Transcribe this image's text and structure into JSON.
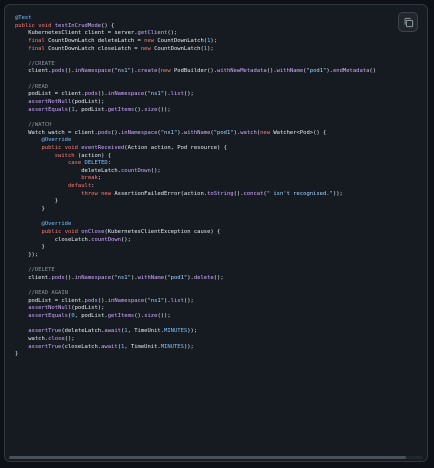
{
  "copy_button": {
    "icon": "copy-icon"
  },
  "code_lines": [
    [
      [
        "anno",
        "@Test"
      ]
    ],
    [
      [
        "kw",
        "public"
      ],
      [
        "plain",
        " "
      ],
      [
        "kw",
        "void"
      ],
      [
        "plain",
        " "
      ],
      [
        "fn",
        "testInCrudMode"
      ],
      [
        "plain",
        "() {"
      ]
    ],
    [
      [
        "plain",
        "    KubernetesClient client = server."
      ],
      [
        "fn",
        "getClient"
      ],
      [
        "plain",
        "();"
      ]
    ],
    [
      [
        "plain",
        "    "
      ],
      [
        "kw",
        "final"
      ],
      [
        "plain",
        " CountDownLatch deleteLatch = "
      ],
      [
        "kw",
        "new"
      ],
      [
        "plain",
        " CountDownLatch("
      ],
      [
        "num",
        "1"
      ],
      [
        "plain",
        ");"
      ]
    ],
    [
      [
        "plain",
        "    "
      ],
      [
        "kw",
        "final"
      ],
      [
        "plain",
        " CountDownLatch closeLatch = "
      ],
      [
        "kw",
        "new"
      ],
      [
        "plain",
        " CountDownLatch("
      ],
      [
        "num",
        "1"
      ],
      [
        "plain",
        ");"
      ]
    ],
    [
      [
        "plain",
        ""
      ]
    ],
    [
      [
        "comment",
        "    //CREATE"
      ]
    ],
    [
      [
        "plain",
        "    client."
      ],
      [
        "fn",
        "pods"
      ],
      [
        "plain",
        "()."
      ],
      [
        "fn",
        "inNamespace"
      ],
      [
        "plain",
        "("
      ],
      [
        "str",
        "\"ns1\""
      ],
      [
        "plain",
        ")."
      ],
      [
        "fn",
        "create"
      ],
      [
        "plain",
        "("
      ],
      [
        "kw",
        "new"
      ],
      [
        "plain",
        " PodBuilder()."
      ],
      [
        "fn",
        "withNewMetadata"
      ],
      [
        "plain",
        "()."
      ],
      [
        "fn",
        "withName"
      ],
      [
        "plain",
        "("
      ],
      [
        "str",
        "\"pod1\""
      ],
      [
        "plain",
        ")."
      ],
      [
        "fn",
        "endMetadata"
      ],
      [
        "plain",
        "()"
      ]
    ],
    [
      [
        "plain",
        ""
      ]
    ],
    [
      [
        "comment",
        "    //READ"
      ]
    ],
    [
      [
        "plain",
        "    podList = client."
      ],
      [
        "fn",
        "pods"
      ],
      [
        "plain",
        "()."
      ],
      [
        "fn",
        "inNamespace"
      ],
      [
        "plain",
        "("
      ],
      [
        "str",
        "\"ns1\""
      ],
      [
        "plain",
        ")."
      ],
      [
        "fn",
        "list"
      ],
      [
        "plain",
        "();"
      ]
    ],
    [
      [
        "plain",
        "    "
      ],
      [
        "fn",
        "assertNotNull"
      ],
      [
        "plain",
        "(podList);"
      ]
    ],
    [
      [
        "plain",
        "    "
      ],
      [
        "fn",
        "assertEquals"
      ],
      [
        "plain",
        "("
      ],
      [
        "num",
        "1"
      ],
      [
        "plain",
        ", podList."
      ],
      [
        "fn",
        "getItems"
      ],
      [
        "plain",
        "()."
      ],
      [
        "fn",
        "size"
      ],
      [
        "plain",
        "());"
      ]
    ],
    [
      [
        "plain",
        ""
      ]
    ],
    [
      [
        "comment",
        "    //WATCH"
      ]
    ],
    [
      [
        "plain",
        "    Watch watch = client."
      ],
      [
        "fn",
        "pods"
      ],
      [
        "plain",
        "()."
      ],
      [
        "fn",
        "inNamespace"
      ],
      [
        "plain",
        "("
      ],
      [
        "str",
        "\"ns1\""
      ],
      [
        "plain",
        ")."
      ],
      [
        "fn",
        "withName"
      ],
      [
        "plain",
        "("
      ],
      [
        "str",
        "\"pod1\""
      ],
      [
        "plain",
        ")."
      ],
      [
        "fn",
        "watch"
      ],
      [
        "plain",
        "("
      ],
      [
        "kw",
        "new"
      ],
      [
        "plain",
        " Watcher<Pod>() {"
      ]
    ],
    [
      [
        "anno",
        "        @Override"
      ]
    ],
    [
      [
        "plain",
        "        "
      ],
      [
        "kw",
        "public"
      ],
      [
        "plain",
        " "
      ],
      [
        "kw",
        "void"
      ],
      [
        "plain",
        " "
      ],
      [
        "fn",
        "eventReceived"
      ],
      [
        "plain",
        "(Action action, Pod resource) {"
      ]
    ],
    [
      [
        "plain",
        "            "
      ],
      [
        "kw",
        "switch"
      ],
      [
        "plain",
        " (action) {"
      ]
    ],
    [
      [
        "plain",
        "                "
      ],
      [
        "kw",
        "case"
      ],
      [
        "plain",
        " "
      ],
      [
        "const",
        "DELETED"
      ],
      [
        "plain",
        ":"
      ]
    ],
    [
      [
        "plain",
        "                    deleteLatch."
      ],
      [
        "fn",
        "countDown"
      ],
      [
        "plain",
        "();"
      ]
    ],
    [
      [
        "plain",
        "                    "
      ],
      [
        "kw",
        "break"
      ],
      [
        "plain",
        ";"
      ]
    ],
    [
      [
        "plain",
        "                "
      ],
      [
        "kw",
        "default"
      ],
      [
        "plain",
        ":"
      ]
    ],
    [
      [
        "plain",
        "                    "
      ],
      [
        "kw",
        "throw"
      ],
      [
        "plain",
        " "
      ],
      [
        "kw",
        "new"
      ],
      [
        "plain",
        " AssertionFailedError(action."
      ],
      [
        "fn",
        "toString"
      ],
      [
        "plain",
        "()."
      ],
      [
        "fn",
        "concat"
      ],
      [
        "plain",
        "("
      ],
      [
        "str",
        "\" isn't recognised.\""
      ],
      [
        "plain",
        "));"
      ]
    ],
    [
      [
        "plain",
        "            }"
      ]
    ],
    [
      [
        "plain",
        "        }"
      ]
    ],
    [
      [
        "plain",
        ""
      ]
    ],
    [
      [
        "anno",
        "        @Override"
      ]
    ],
    [
      [
        "plain",
        "        "
      ],
      [
        "kw",
        "public"
      ],
      [
        "plain",
        " "
      ],
      [
        "kw",
        "void"
      ],
      [
        "plain",
        " "
      ],
      [
        "fn",
        "onClose"
      ],
      [
        "plain",
        "(KubernetesClientException cause) {"
      ]
    ],
    [
      [
        "plain",
        "            closeLatch."
      ],
      [
        "fn",
        "countDown"
      ],
      [
        "plain",
        "();"
      ]
    ],
    [
      [
        "plain",
        "        }"
      ]
    ],
    [
      [
        "plain",
        "    });"
      ]
    ],
    [
      [
        "plain",
        ""
      ]
    ],
    [
      [
        "comment",
        "    //DELETE"
      ]
    ],
    [
      [
        "plain",
        "    client."
      ],
      [
        "fn",
        "pods"
      ],
      [
        "plain",
        "()."
      ],
      [
        "fn",
        "inNamespace"
      ],
      [
        "plain",
        "("
      ],
      [
        "str",
        "\"ns1\""
      ],
      [
        "plain",
        ")."
      ],
      [
        "fn",
        "withName"
      ],
      [
        "plain",
        "("
      ],
      [
        "str",
        "\"pod1\""
      ],
      [
        "plain",
        ")."
      ],
      [
        "fn",
        "delete"
      ],
      [
        "plain",
        "();"
      ]
    ],
    [
      [
        "plain",
        ""
      ]
    ],
    [
      [
        "comment",
        "    //READ AGAIN"
      ]
    ],
    [
      [
        "plain",
        "    podList = client."
      ],
      [
        "fn",
        "pods"
      ],
      [
        "plain",
        "()."
      ],
      [
        "fn",
        "inNamespace"
      ],
      [
        "plain",
        "("
      ],
      [
        "str",
        "\"ns1\""
      ],
      [
        "plain",
        ")."
      ],
      [
        "fn",
        "list"
      ],
      [
        "plain",
        "();"
      ]
    ],
    [
      [
        "plain",
        "    "
      ],
      [
        "fn",
        "assertNotNull"
      ],
      [
        "plain",
        "(podList);"
      ]
    ],
    [
      [
        "plain",
        "    "
      ],
      [
        "fn",
        "assertEquals"
      ],
      [
        "plain",
        "("
      ],
      [
        "num",
        "0"
      ],
      [
        "plain",
        ", podList."
      ],
      [
        "fn",
        "getItems"
      ],
      [
        "plain",
        "()."
      ],
      [
        "fn",
        "size"
      ],
      [
        "plain",
        "());"
      ]
    ],
    [
      [
        "plain",
        ""
      ]
    ],
    [
      [
        "plain",
        "    "
      ],
      [
        "fn",
        "assertTrue"
      ],
      [
        "plain",
        "(deleteLatch."
      ],
      [
        "fn",
        "await"
      ],
      [
        "plain",
        "("
      ],
      [
        "num",
        "1"
      ],
      [
        "plain",
        ", TimeUnit."
      ],
      [
        "const",
        "MINUTES"
      ],
      [
        "plain",
        "));"
      ]
    ],
    [
      [
        "plain",
        "    watch."
      ],
      [
        "fn",
        "close"
      ],
      [
        "plain",
        "();"
      ]
    ],
    [
      [
        "plain",
        "    "
      ],
      [
        "fn",
        "assertTrue"
      ],
      [
        "plain",
        "(closeLatch."
      ],
      [
        "fn",
        "await"
      ],
      [
        "plain",
        "("
      ],
      [
        "num",
        "1"
      ],
      [
        "plain",
        ", TimeUnit."
      ],
      [
        "const",
        "MINUTES"
      ],
      [
        "plain",
        "));"
      ]
    ],
    [
      [
        "plain",
        "}"
      ]
    ]
  ]
}
